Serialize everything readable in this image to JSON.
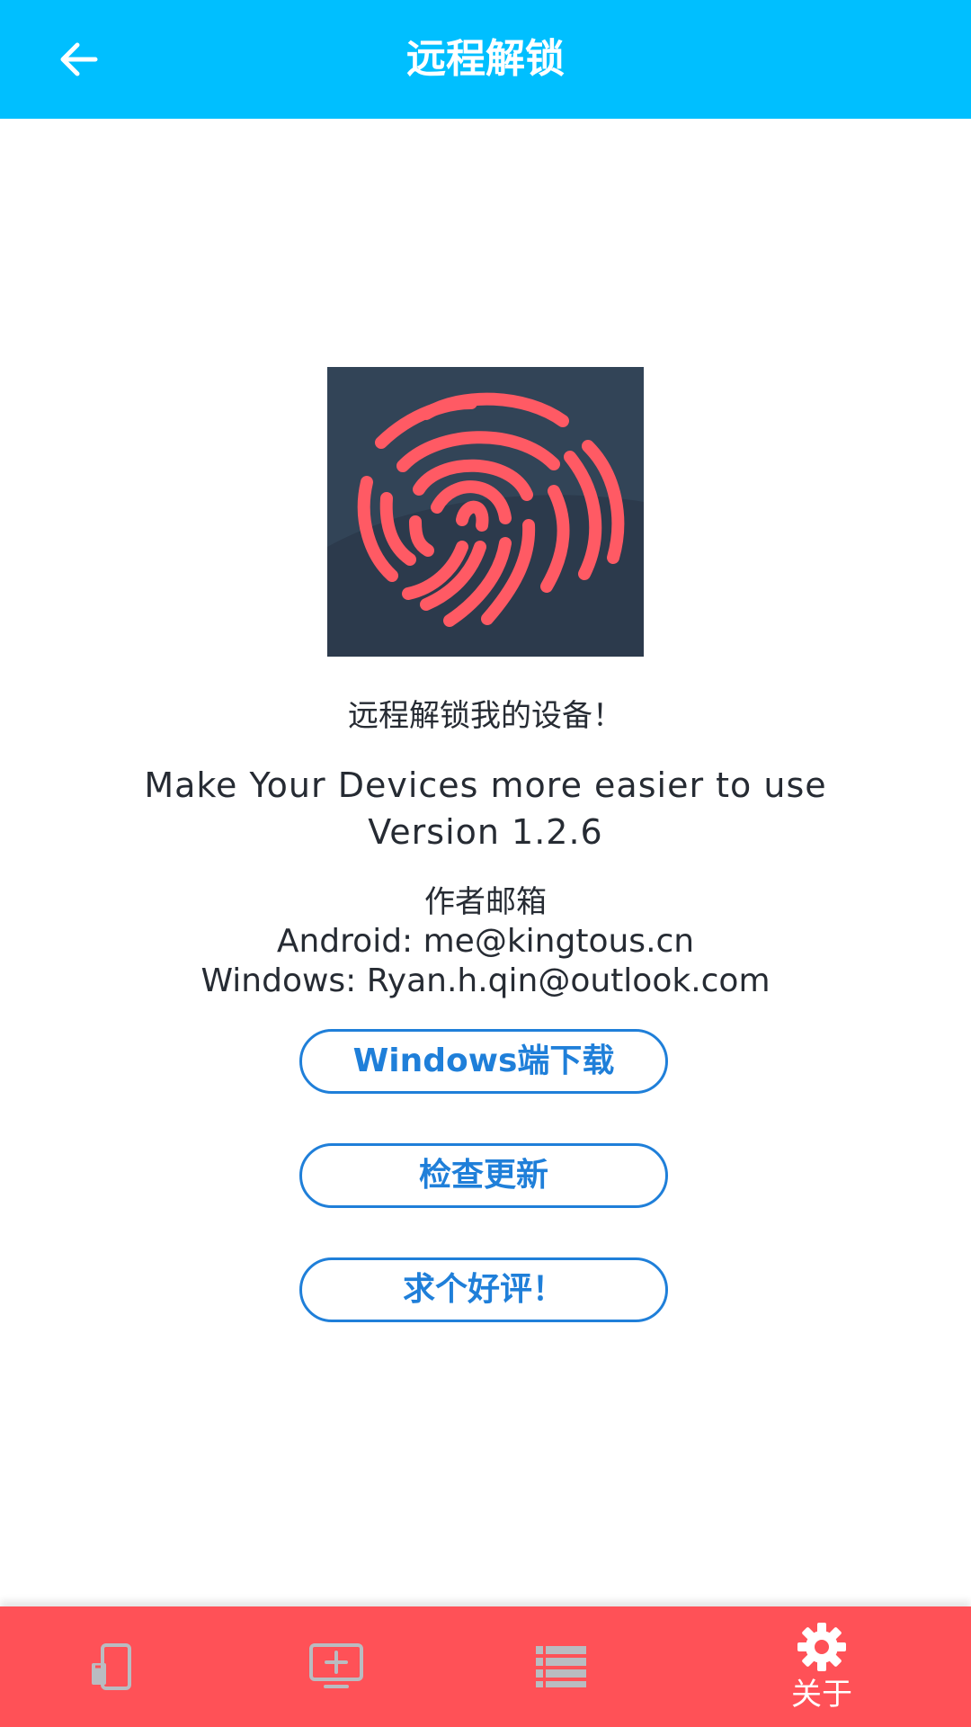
{
  "app_bar": {
    "title": "远程解锁",
    "back_icon": "arrow-left-icon"
  },
  "about": {
    "logo_icon": "fingerprint-icon",
    "tagline": "远程解锁我的设备！",
    "slogan": "Make Your Devices more easier to use",
    "version": "Version 1.2.6",
    "author_heading": "作者邮箱",
    "android_contact": "Android: me@kingtous.cn",
    "windows_contact": "Windows: Ryan.h.qin@outlook.com"
  },
  "buttons": {
    "download_windows": "Windows端下载",
    "check_update": "检查更新",
    "review": "求个好评！"
  },
  "bottom_nav": {
    "items": [
      {
        "icon": "phone-devices-icon",
        "label": ""
      },
      {
        "icon": "add-screen-icon",
        "label": ""
      },
      {
        "icon": "list-icon",
        "label": ""
      },
      {
        "icon": "gear-icon",
        "label": "关于",
        "selected": true
      }
    ]
  },
  "colors": {
    "app_bar": "#00bfff",
    "bottom_nav": "#ff5157",
    "button_accent": "#1f7fd9",
    "logo_bg": "#324457",
    "fingerprint": "#ff5a64",
    "inactive_icon": "#b9bcc1"
  }
}
